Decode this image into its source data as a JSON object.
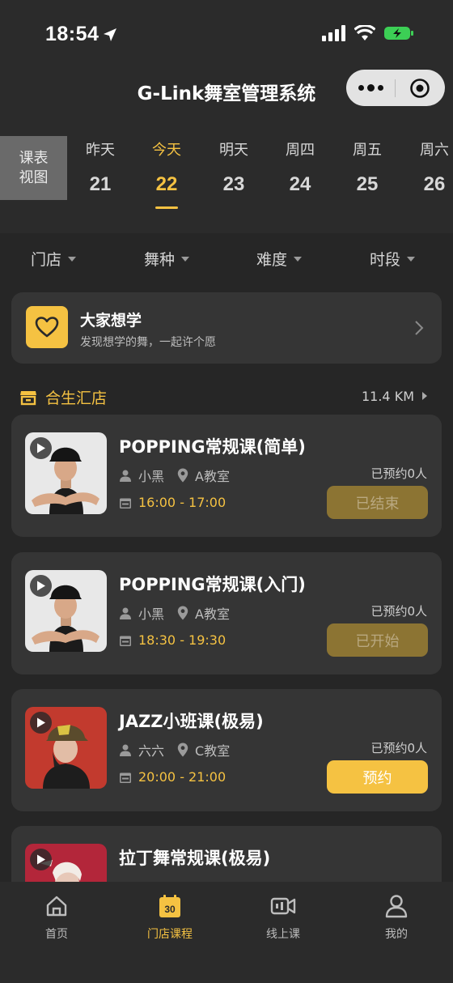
{
  "status": {
    "time": "18:54"
  },
  "nav": {
    "title": "G-Link舞室管理系统"
  },
  "date_tabs": {
    "view_button": "课表视图",
    "days": [
      {
        "name": "昨天",
        "num": "21"
      },
      {
        "name": "今天",
        "num": "22"
      },
      {
        "name": "明天",
        "num": "23"
      },
      {
        "name": "周四",
        "num": "24"
      },
      {
        "name": "周五",
        "num": "25"
      },
      {
        "name": "周六",
        "num": "26"
      }
    ],
    "active_index": 1
  },
  "filters": [
    "门店",
    "舞种",
    "难度",
    "时段"
  ],
  "wish": {
    "title": "大家想学",
    "subtitle": "发现想学的舞，一起许个愿"
  },
  "store": {
    "name": "合生汇店",
    "distance": "11.4 KM"
  },
  "courses": [
    {
      "title": "POPPING常规课(简单)",
      "teacher": "小黑",
      "room": "A教室",
      "time": "16:00 - 17:00",
      "booked": "已预约0人",
      "button": "已结束"
    },
    {
      "title": "POPPING常规课(入门)",
      "teacher": "小黑",
      "room": "A教室",
      "time": "18:30 - 19:30",
      "booked": "已预约0人",
      "button": "已开始"
    },
    {
      "title": "JAZZ小班课(极易)",
      "teacher": "六六",
      "room": "C教室",
      "time": "20:00 - 21:00",
      "booked": "已预约0人",
      "button": "预约"
    },
    {
      "title": "拉丁舞常规课(极易)",
      "teacher": "",
      "room": "",
      "time": "",
      "booked": "",
      "button": ""
    }
  ],
  "tabbar": [
    {
      "label": "首页",
      "icon": "home-icon"
    },
    {
      "label": "门店课程",
      "icon": "calendar-icon",
      "badge": "30"
    },
    {
      "label": "线上课",
      "icon": "video-icon"
    },
    {
      "label": "我的",
      "icon": "user-icon"
    }
  ],
  "colors": {
    "accent": "#f5c242",
    "background": "#262626",
    "card": "#353535"
  }
}
